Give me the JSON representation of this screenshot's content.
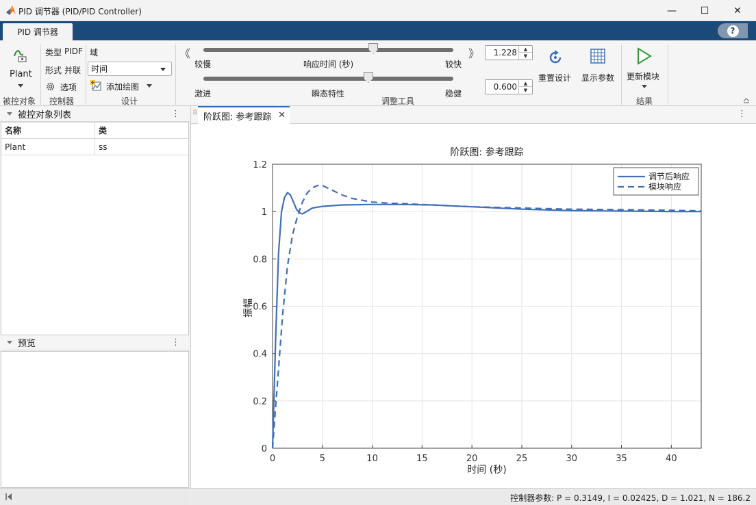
{
  "window": {
    "title": "PID 调节器 (PID/PID Controller)",
    "controls": {
      "minimize": "—",
      "maximize": "☐",
      "close": "✕"
    }
  },
  "app_tab": {
    "label": "PID 调节器"
  },
  "help": {
    "label": "?"
  },
  "ribbon": {
    "plant": {
      "label": "Plant",
      "group": "被控对象"
    },
    "controller": {
      "type_label": "类型",
      "type_value": "PIDF",
      "form_label": "形式",
      "form_value": "并联",
      "options_label": "选项",
      "group": "控制器"
    },
    "design": {
      "domain_label": "域",
      "domain_value": "时间",
      "add_plot_label": "添加绘图",
      "group": "设计"
    },
    "tuning": {
      "response_time": {
        "left": "较慢",
        "center": "响应时间 (秒)",
        "right": "较快",
        "value": "1.228",
        "position": 0.68
      },
      "transient": {
        "left": "激进",
        "center": "瞬态特性",
        "right": "稳健",
        "value": "0.600",
        "position": 0.66
      },
      "group": "调整工具",
      "arrow_left": "《",
      "arrow_right": "》"
    },
    "reset_design": "重置设计",
    "show_params": "显示参数",
    "update_block": "更新模块",
    "results_group": "结果"
  },
  "left_panel": {
    "plants_title": "被控对象列表",
    "table": {
      "headers": [
        "名称",
        "类"
      ],
      "rows": [
        [
          "Plant",
          "ss"
        ]
      ]
    },
    "preview_title": "预览",
    "menu_dots": "⋮"
  },
  "document": {
    "tab_label": "阶跃图: 参考跟踪",
    "close": "✕"
  },
  "status": {
    "text": "控制器参数: P = 0.3149, I = 0.02425, D = 1.021, N = 186.2"
  },
  "chart_data": {
    "type": "line",
    "title": "阶跃图: 参考跟踪",
    "xlabel": "时间 (秒)",
    "ylabel": "振幅",
    "xlim": [
      0,
      43
    ],
    "ylim": [
      0,
      1.2
    ],
    "xticks": [
      "0",
      "5",
      "10",
      "15",
      "20",
      "25",
      "30",
      "35",
      "40"
    ],
    "yticks": [
      "0",
      "0.2",
      "0.4",
      "0.6",
      "0.8",
      "1",
      "1.2"
    ],
    "grid": true,
    "legend_position": "top-right",
    "series": [
      {
        "name": "调节后响应",
        "style": "solid",
        "color": "#3f6eb8",
        "x": [
          0,
          0.3,
          0.6,
          0.9,
          1.2,
          1.5,
          1.8,
          2.1,
          2.4,
          2.7,
          3.0,
          3.4,
          4,
          5,
          7,
          10,
          13,
          16,
          20,
          25,
          30,
          35,
          40,
          43
        ],
        "y": [
          0,
          0.45,
          0.82,
          1.0,
          1.06,
          1.08,
          1.07,
          1.04,
          1.01,
          0.995,
          0.99,
          1.0,
          1.015,
          1.022,
          1.028,
          1.03,
          1.03,
          1.028,
          1.02,
          1.01,
          1.004,
          1.002,
          1.0,
          1.0
        ]
      },
      {
        "name": "模块响应",
        "style": "dashed",
        "color": "#3f6eb8",
        "x": [
          0,
          0.5,
          1,
          1.5,
          2,
          2.5,
          3,
          3.5,
          4,
          4.5,
          5,
          6,
          7,
          8,
          10,
          12,
          15,
          20,
          25,
          30,
          35,
          40,
          43
        ],
        "y": [
          0,
          0.28,
          0.56,
          0.77,
          0.9,
          0.98,
          1.04,
          1.08,
          1.1,
          1.11,
          1.11,
          1.09,
          1.07,
          1.055,
          1.04,
          1.035,
          1.03,
          1.02,
          1.015,
          1.01,
          1.008,
          1.005,
          1.003
        ]
      }
    ]
  }
}
